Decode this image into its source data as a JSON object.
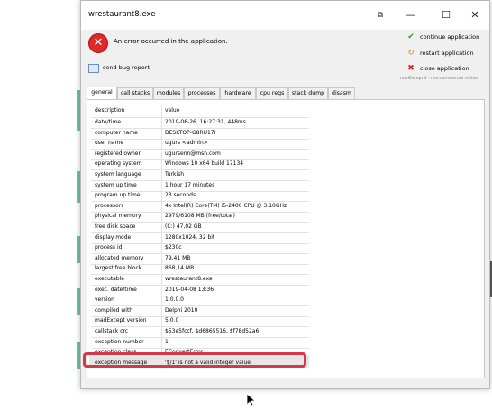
{
  "window": {
    "title": "wrestaurant8.exe",
    "controls": {
      "restore_label": "⧉",
      "minimize_label": "—",
      "maximize_label": "☐",
      "close_label": "✕"
    }
  },
  "error": {
    "icon": "error-icon",
    "message": "An error occurred in the application."
  },
  "actions": [
    {
      "label": "continue application",
      "icon": "checkmark-icon",
      "glyph": "✔",
      "color": "#3a9a3a"
    },
    {
      "label": "restart application",
      "icon": "restart-icon",
      "glyph": "↻",
      "color": "#d88a1a"
    },
    {
      "label": "close application",
      "icon": "close-icon",
      "glyph": "✖",
      "color": "#d0202a"
    }
  ],
  "madexcept_note": "madExcept 4 - non-commercial edition",
  "bug_report": {
    "label": "send bug report",
    "icon": "mail-icon"
  },
  "tabs": [
    "general",
    "call stacks",
    "modules",
    "processes",
    "hardware",
    "cpu regs",
    "stack dump",
    "disasm"
  ],
  "table": {
    "header": {
      "key": "description",
      "value": "value"
    },
    "rows": [
      {
        "key": "date/time",
        "value": "2019-06-26, 16:27:31, 448ms"
      },
      {
        "key": "computer name",
        "value": "DESKTOP-G8RU17I"
      },
      {
        "key": "user name",
        "value": "ugurs  <admin>"
      },
      {
        "key": "registered owner",
        "value": "ugursenn@msn.com"
      },
      {
        "key": "operating system",
        "value": "Windows 10 x64 build 17134"
      },
      {
        "key": "system language",
        "value": "Turkish"
      },
      {
        "key": "system up time",
        "value": "1 hour 17 minutes"
      },
      {
        "key": "program up time",
        "value": "23 seconds"
      },
      {
        "key": "processors",
        "value": "4x Intel(R) Core(TM) i5-2400 CPU @ 3.10GHz"
      },
      {
        "key": "physical memory",
        "value": "2979/6108 MB (free/total)"
      },
      {
        "key": "free disk space",
        "value": "(C:) 47,02 GB"
      },
      {
        "key": "display mode",
        "value": "1280x1024, 32 bit"
      },
      {
        "key": "process id",
        "value": "$230c"
      },
      {
        "key": "allocated memory",
        "value": "79,41 MB"
      },
      {
        "key": "largest free block",
        "value": "868,14 MB"
      },
      {
        "key": "executable",
        "value": "wrestaurant8.exe"
      },
      {
        "key": "exec. date/time",
        "value": "2019-04-08 13:36"
      },
      {
        "key": "version",
        "value": "1.0.0.0"
      },
      {
        "key": "compiled with",
        "value": "Delphi 2010"
      },
      {
        "key": "madExcept version",
        "value": "5.0.0"
      },
      {
        "key": "callstack crc",
        "value": "$53e5fccf, $d6865516, $f78d52a6"
      },
      {
        "key": "exception number",
        "value": "1"
      },
      {
        "key": "exception class",
        "value": "EConvertError"
      },
      {
        "key": "exception message",
        "value": "'$/1' is not a valid integer value."
      }
    ]
  }
}
